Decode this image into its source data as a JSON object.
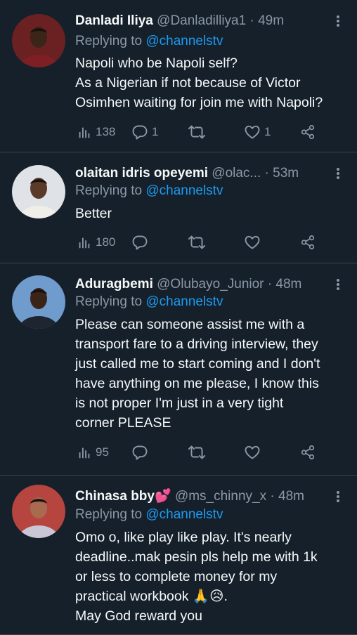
{
  "accent": "#1d9bf0",
  "background": "#15202b",
  "tweets": [
    {
      "name": "Danladi Iliya",
      "name_emoji": "",
      "handle": "@Danladilliya1",
      "separator": "·",
      "time": "49m",
      "reply_prefix": "Replying to",
      "reply_to": "@channelstv",
      "lines": [
        "Napoli who be Napoli self?",
        "As a Nigerian if not because of Victor",
        "Osimhen waiting for join me with Napoli?"
      ],
      "views": "138",
      "replies": "1",
      "retweets": "",
      "likes": "1",
      "icons": [
        "views-icon",
        "reply-icon",
        "retweet-icon",
        "like-icon",
        "share-icon"
      ]
    },
    {
      "name": "olaitan idris opeyemi",
      "name_emoji": "",
      "handle": "@olac...",
      "separator": "·",
      "time": "53m",
      "reply_prefix": "Replying to",
      "reply_to": "@channelstv",
      "lines": [
        "Better"
      ],
      "views": "180",
      "replies": "",
      "retweets": "",
      "likes": ""
    },
    {
      "name": "Aduragbemi",
      "name_emoji": "",
      "handle": "@Olubayo_Junior",
      "separator": "·",
      "time": "48m",
      "reply_prefix": "Replying to",
      "reply_to": "@channelstv",
      "lines": [
        "Please can someone assist me with a",
        "transport fare to a driving  interview, they",
        "just called me to start coming and I don't",
        "have anything on me please, I know this",
        "is not  proper I'm just in a very tight",
        "corner PLEASE"
      ],
      "views": "95",
      "replies": "",
      "retweets": "",
      "likes": ""
    },
    {
      "name": "Chinasa bby",
      "name_emoji": "💕",
      "handle": "@ms_chinny_x",
      "separator": "·",
      "time": "48m",
      "reply_prefix": "Replying to",
      "reply_to": "@channelstv",
      "lines": [
        "Omo o, like play like play. It's nearly",
        "deadline..mak pesin pls help me with 1k",
        "or less to complete money for my",
        "practical workbook 🙏😥.",
        "May God reward you"
      ]
    }
  ]
}
